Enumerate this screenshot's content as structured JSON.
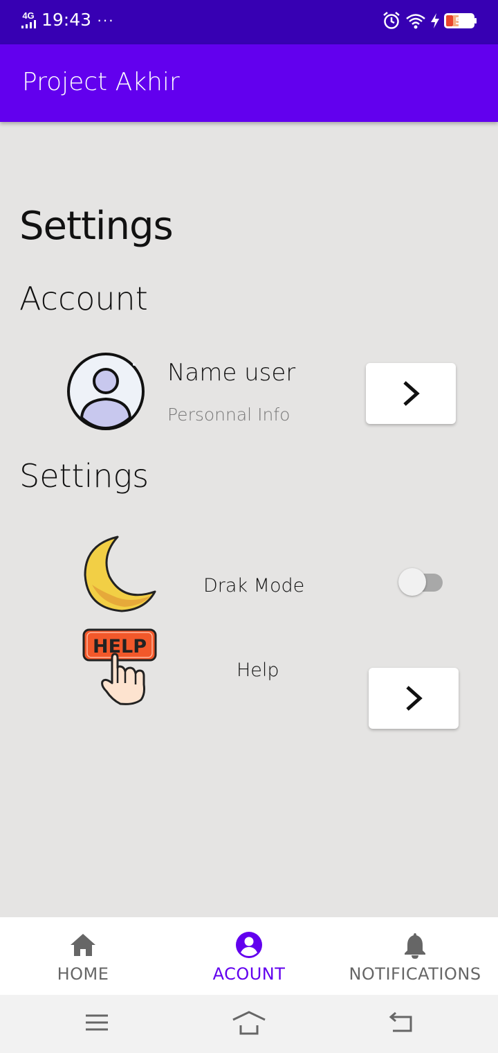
{
  "status_bar": {
    "network": "4G",
    "time": "19:43",
    "more": "···",
    "icons": [
      "signal-icon",
      "alarm-icon",
      "wifi-icon",
      "charging-icon",
      "battery-icon"
    ],
    "battery_level": "5"
  },
  "app_bar": {
    "title": "Project Akhir",
    "color": "#6200ee"
  },
  "page": {
    "title": "Settings"
  },
  "account_section": {
    "title": "Account",
    "user_name": "Name user",
    "subtitle": "Personnal Info",
    "icons": [
      "avatar-icon",
      "chevron-right-icon"
    ]
  },
  "settings_section": {
    "title": "Settings",
    "dark_mode_label": "Drak Mode",
    "dark_mode_enabled": false,
    "help_label": "Help",
    "help_icon_text": "HELP",
    "icons": [
      "moon-icon",
      "help-icon",
      "chevron-right-icon"
    ]
  },
  "bottom_nav": {
    "items": [
      {
        "label": "HOME",
        "icon": "home-icon",
        "active": false
      },
      {
        "label": "ACOUNT",
        "icon": "account-circle-icon",
        "active": true
      },
      {
        "label": "NOTIFICATIONS",
        "icon": "bell-icon",
        "active": false
      }
    ],
    "active_color": "#6200ee"
  },
  "system_nav": {
    "icons": [
      "menu-icon",
      "home-outline-icon",
      "back-icon"
    ]
  }
}
